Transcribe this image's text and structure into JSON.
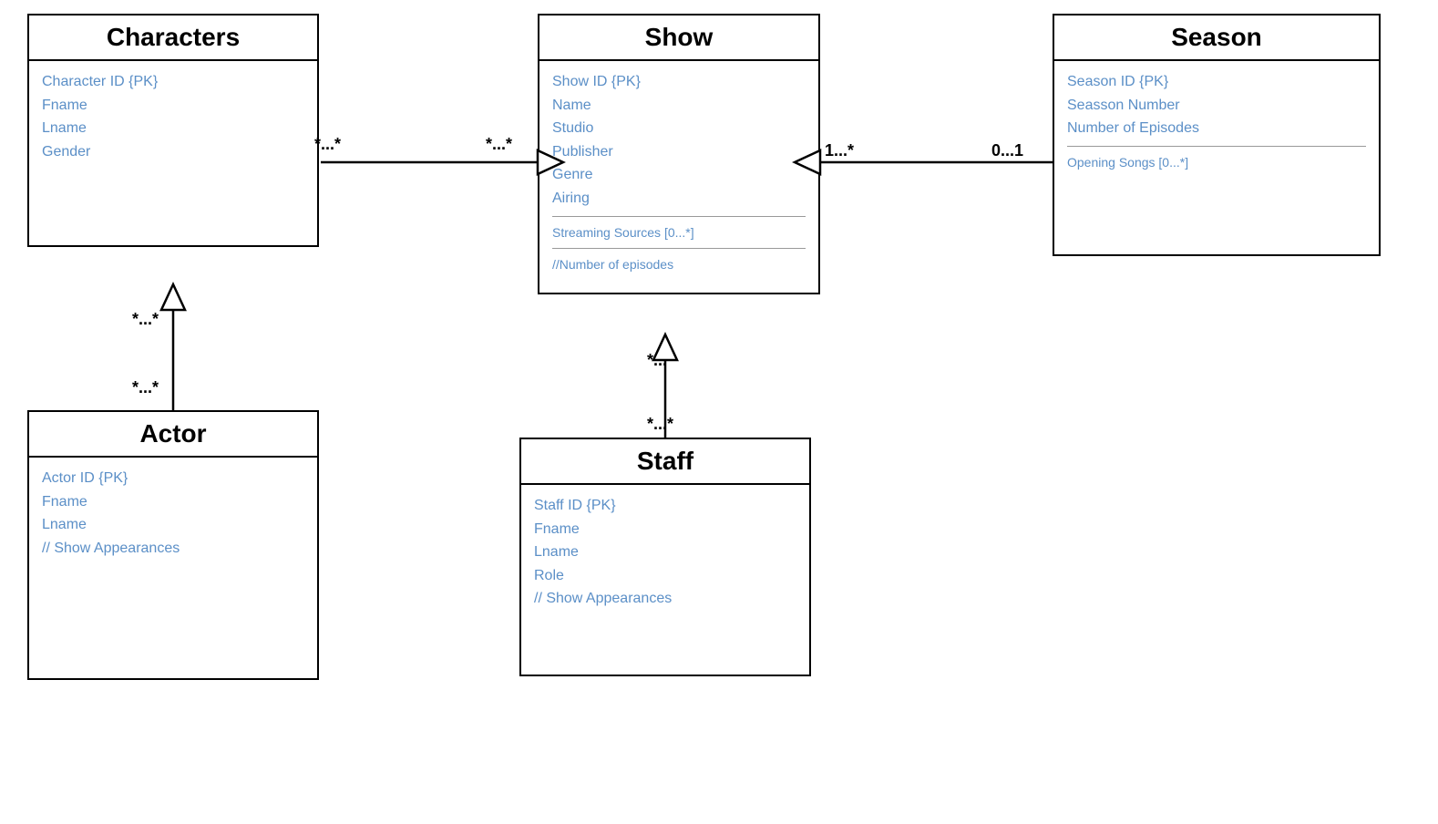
{
  "characters": {
    "title": "Characters",
    "attributes": [
      "Character ID  {PK}",
      "Fname",
      "Lname",
      "Gender"
    ]
  },
  "show": {
    "title": "Show",
    "attributes": [
      "Show ID  {PK}",
      "Name",
      "Studio",
      "Publisher",
      "Genre",
      "Airing"
    ],
    "derived_single": "Streaming Sources  [0...*]",
    "derived_double": "//Number of episodes"
  },
  "season": {
    "title": "Season",
    "attributes": [
      "Season ID  {PK}",
      "Seasson Number",
      "Number of Episodes"
    ],
    "derived_single": "Opening Songs  [0...*]"
  },
  "actor": {
    "title": "Actor",
    "attributes": [
      "Actor ID  {PK}",
      "Fname",
      "Lname",
      "//  Show Appearances"
    ]
  },
  "staff": {
    "title": "Staff",
    "attributes": [
      "Staff ID  {PK}",
      "Fname",
      "Lname",
      "Role",
      "//  Show Appearances"
    ]
  },
  "relationships": {
    "char_show_left": "*...*",
    "char_show_right": "*...*",
    "show_season_left": "1...*",
    "show_season_right": "0...1",
    "actor_char_top": "*...*",
    "actor_char_bottom": "*...*",
    "staff_show_top": "*...*",
    "staff_show_bottom": "*...*"
  }
}
